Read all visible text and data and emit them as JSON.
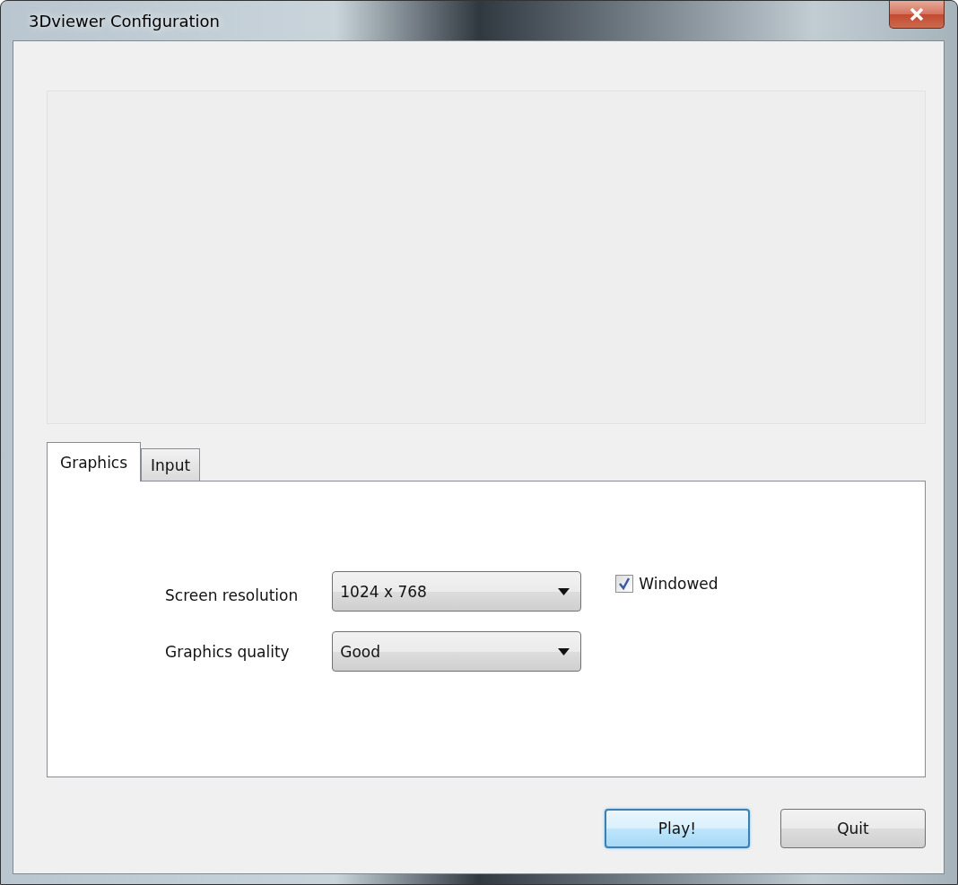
{
  "window": {
    "title": "3Dviewer Configuration"
  },
  "tabs": [
    {
      "label": "Graphics",
      "selected": true
    },
    {
      "label": "Input",
      "selected": false
    }
  ],
  "settings": [
    {
      "label": "Screen resolution",
      "value": "1024 x 768"
    },
    {
      "label": "Graphics quality",
      "value": "Good"
    }
  ],
  "windowed": {
    "label": "Windowed",
    "checked": true
  },
  "buttons": [
    {
      "label": "Play!",
      "default": true
    },
    {
      "label": "Quit",
      "default": false
    }
  ]
}
